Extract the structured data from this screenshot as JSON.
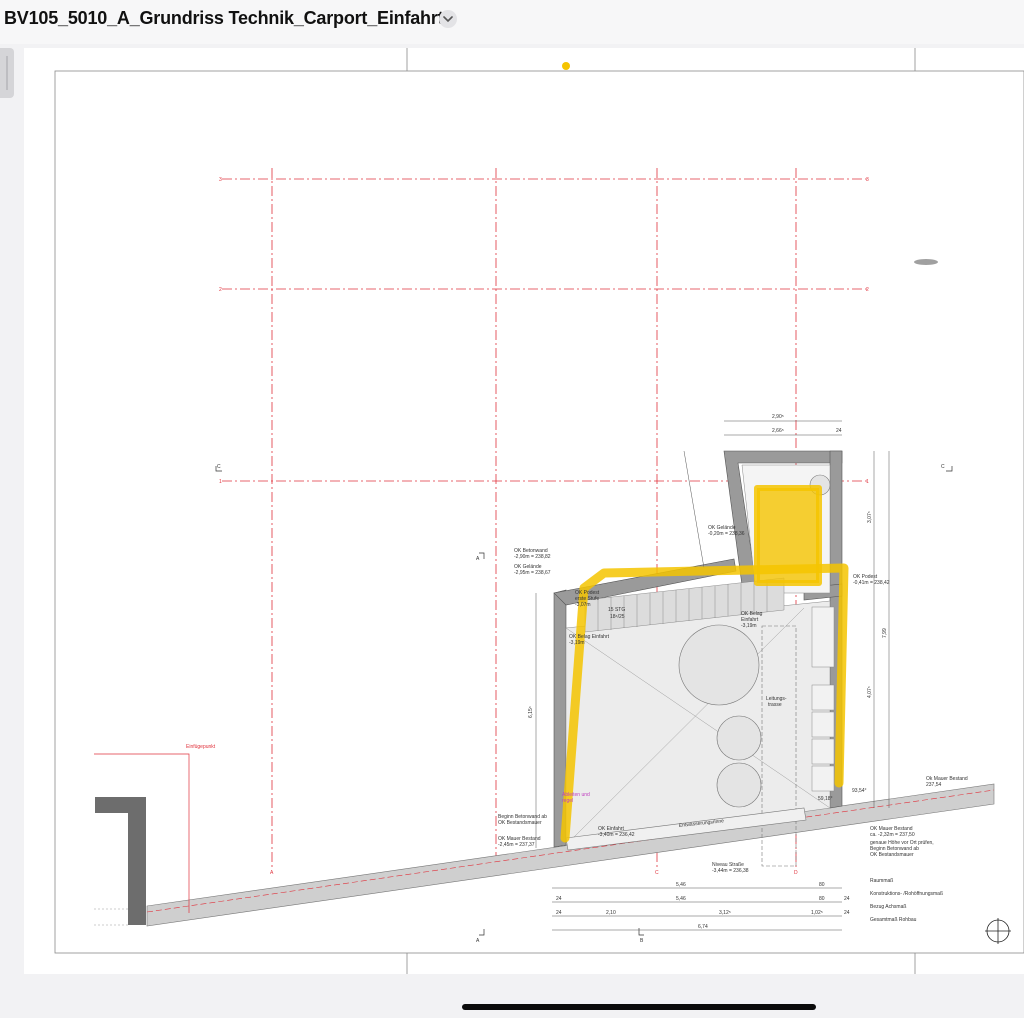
{
  "header": {
    "document_title": "BV105_5010_A_Grundriss Technik_Carport_Einfahrt"
  },
  "icons": {
    "title_menu": "chevron-down-icon",
    "north_arrow": "north-arrow-icon",
    "sidebar": "sidebar-handle-icon"
  },
  "colors": {
    "grid_red": "#e0323c",
    "highlight_yellow": "#f5c400",
    "wall_grey": "#8a8a8a",
    "slab_grey": "#dedede"
  },
  "plan": {
    "grid_axes": {
      "rows": [
        "3",
        "2",
        "1"
      ],
      "columns": [
        "A",
        "B",
        "C",
        "D"
      ],
      "section_c": "C",
      "section_a": "A",
      "section_b": "B"
    },
    "dims_top": {
      "d1": "2,90⁵",
      "d2": "2,66⁵",
      "d3": "24"
    },
    "dims_side": {
      "left": "6,15⁵",
      "right_total": "7,99",
      "right_upper": "3,07⁵",
      "right_lower": "4,07⁵"
    },
    "labels": {
      "einfuegepunkt": "Einfügepunkt",
      "ok_betonwand": "OK Betonwand",
      "ok_betonwand_val": "-2,90m = 238,82",
      "ok_gelaende_left": "OK Gelände",
      "ok_gelaende_left_val": "-2,95m = 238,67",
      "ok_podest": "OK Podest",
      "ok_podest_sub": "erste Stufe",
      "ok_podest_val": "-3,07m",
      "stairs": "15 STG",
      "stairs_sub": "18⁶/25",
      "ok_belag_left": "OK Belag Einfahrt",
      "ok_belag_left_val": "-3,19m",
      "ok_gelaende_mid": "OK Gelände",
      "ok_gelaende_mid_val": "-0,20m = 238,36",
      "ok_belag_mid": "OK Belag",
      "ok_belag_mid_sub": "Einfahrt",
      "ok_belag_mid_val": "-3,19m",
      "ok_podest_right": "OK Podest",
      "ok_podest_right_val": "-0,41m = 238,42",
      "leitungstrasse": "Leitungs-",
      "leitungstrasse_2": "trasse",
      "beginn_betonwand": "Beginn Betonwand ab",
      "beginn_betonwand_2": "OK Bestandsmauer",
      "ok_mauer_left": "OK Mauer Bestand",
      "ok_mauer_left_val": "-2,45m = 237,37",
      "ok_einfahrt": "OK Einfahrt",
      "ok_einfahrt_val": "-3,40m = 236,42",
      "entwaesserung": "Entwässerungsrinne",
      "niveau_strasse": "Niveau Straße",
      "niveau_strasse_val": "-3,44m = 236,38",
      "ok_mauer_right": "Ok Mauer Bestand",
      "ok_mauer_right_val": "237,54",
      "ok_mauer_bestand2": "OK Mauer Bestand",
      "ok_mauer_bestand2_a": "ca. -2,32m = 237,50",
      "ok_mauer_bestand2_b": "genaue Höhe vor Ort prüfen,",
      "ok_mauer_bestand2_c": "Beginn Betonwand ab",
      "ok_mauer_bestand2_d": "OK Bestandsmauer",
      "angle_right": "59,18°",
      "angle_mid": "93,54°",
      "abfluss": "Ableiten und",
      "abfluss_2": "regel"
    },
    "legend": {
      "raummass": "Raummaß",
      "konstruktion": "Konstruktions- /Rohöffnungsmaß",
      "bezug": "Bezug Achsmaß",
      "gesamt": "Gesamtmaß Rohbau"
    },
    "dims_bottom": {
      "r1_a": "5,46",
      "r1_b": "80",
      "r2_a": "24",
      "r2_b": "5,46",
      "r2_c": "80",
      "r2_d": "24",
      "r3_a": "24",
      "r3_b": "2,10",
      "r3_c": "3,12⁵",
      "r3_d": "1,02⁵",
      "r3_e": "24",
      "r4": "6,74"
    }
  }
}
